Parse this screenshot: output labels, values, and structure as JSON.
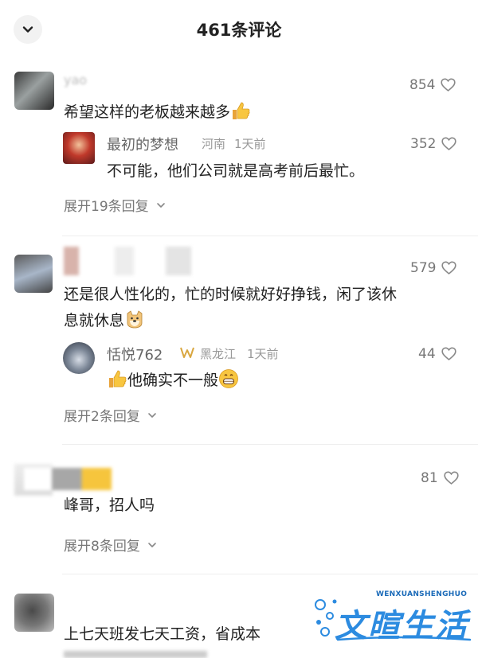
{
  "header": {
    "title": "461条评论"
  },
  "comments": [
    {
      "username": "yao",
      "text": "希望这样的老板越来越多",
      "likes": "854",
      "reply": {
        "username": "最初的梦想",
        "location": "河南",
        "time": "1天前",
        "text": "不可能，他们公司就是高考前后最忙。",
        "likes": "352"
      },
      "expand": "展开19条回复"
    },
    {
      "text_line1": "还是很人性化的，忙的时候就好好挣钱，闲了该休",
      "text_line2": "息就休息",
      "likes": "579",
      "reply": {
        "username": "恬悦762",
        "location": "黑龙江",
        "time": "1天前",
        "text": "他确实不一般",
        "likes": "44"
      },
      "expand": "展开2条回复"
    },
    {
      "text": "峰哥，招人吗",
      "likes": "81",
      "expand": "展开8条回复"
    },
    {
      "text": "上七天班发七天工资，省成本"
    }
  ],
  "watermark": {
    "small": "WENXUANSHENGHUO",
    "big": "文暄生活"
  },
  "colors": {
    "accent": "#2c8be0",
    "like_gray": "#777777",
    "meta_gray": "#999999"
  }
}
